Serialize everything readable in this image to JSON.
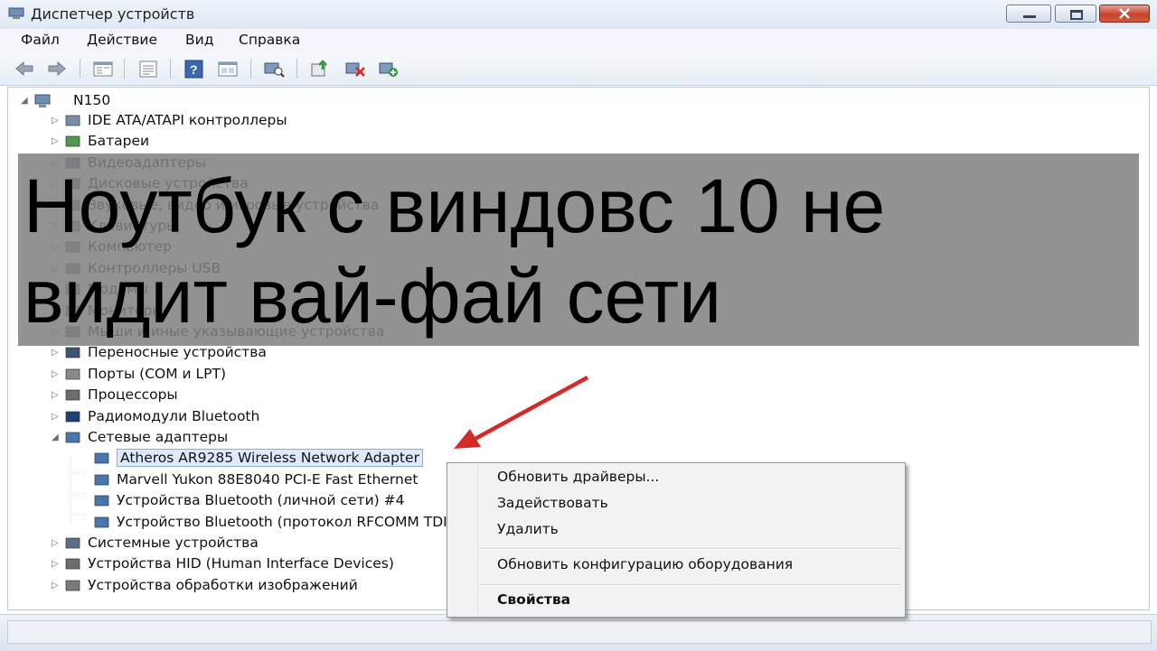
{
  "window": {
    "title": "Диспетчер устройств"
  },
  "menu": [
    "Файл",
    "Действие",
    "Вид",
    "Справка"
  ],
  "toolbar": {
    "icons": [
      "back-icon",
      "forward-icon",
      "tree-view-icon",
      "properties-icon",
      "help-icon",
      "view-icon",
      "scan-icon",
      "update-driver-icon",
      "disable-icon",
      "enable-icon"
    ]
  },
  "tree": {
    "root": "N150",
    "categories": [
      "IDE ATA/ATAPI контроллеры",
      "Батареи",
      "Видеоадаптеры",
      "Дисковые устройства",
      "Звуковые, видео и игровые устройства",
      "Клавиатуры",
      "Компьютер",
      "Контроллеры USB",
      "Модемы",
      "Мониторы",
      "Мыши и иные указывающие устройства",
      "Переносные устройства",
      "Порты (COM и LPT)",
      "Процессоры",
      "Радиомодули Bluetooth",
      "Сетевые адаптеры"
    ],
    "network_adapters": [
      "Atheros AR9285 Wireless Network Adapter",
      "Marvell Yukon 88E8040 PCI-E Fast Ethernet",
      "Устройства Bluetooth (личной сети) #4",
      "Устройство Bluetooth (протокол RFCOMM TDI)"
    ],
    "categories_after": [
      "Системные устройства",
      "Устройства HID (Human Interface Devices)",
      "Устройства обработки изображений"
    ]
  },
  "context_menu": {
    "update_drivers": "Обновить драйверы...",
    "enable": "Задействовать",
    "delete": "Удалить",
    "scan": "Обновить конфигурацию оборудования",
    "properties": "Свойства"
  },
  "overlay": {
    "line1": "Ноутбук с виндовс 10 не",
    "line2": "видит вай-фай сети"
  },
  "colors": {
    "arrow": "#d42a2a",
    "selection": "#dceafc",
    "overlay": "#808080"
  }
}
